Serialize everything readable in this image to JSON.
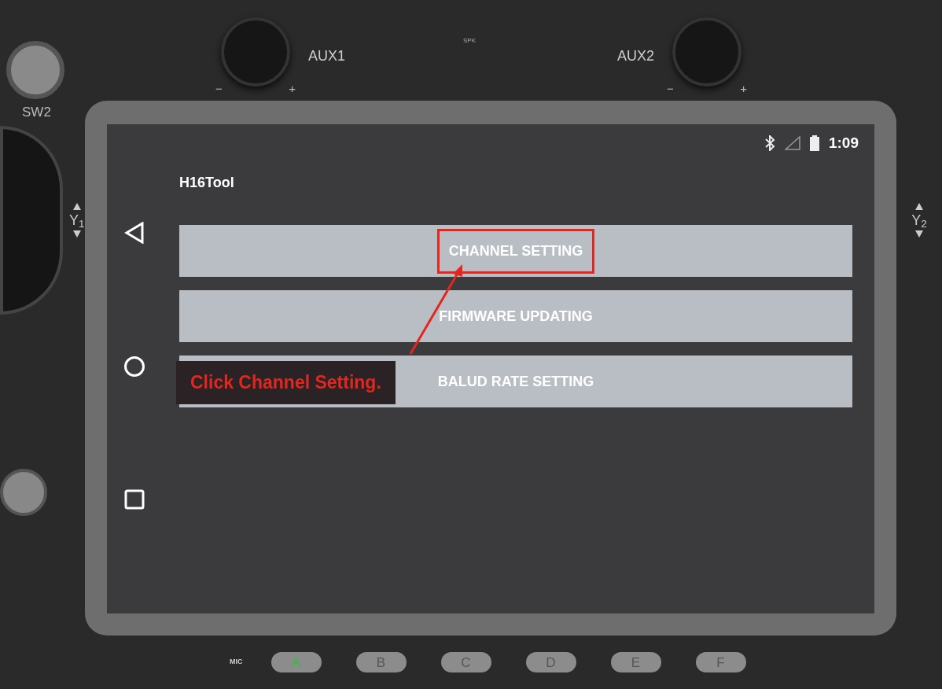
{
  "device": {
    "switch_label": "SW2",
    "knob_left": {
      "label": "AUX1",
      "minus": "−",
      "plus": "+"
    },
    "speaker_label": "SPK",
    "knob_right": {
      "label": "AUX2",
      "minus": "−",
      "plus": "+"
    },
    "stick_left_label": "Y$_{1}$",
    "stick_right_label": "Y$_{2}$",
    "mic_label": "MIC",
    "buttons": [
      {
        "label": "A",
        "lit": true
      },
      {
        "label": "B",
        "lit": false
      },
      {
        "label": "C",
        "lit": false
      },
      {
        "label": "D",
        "lit": false
      },
      {
        "label": "E",
        "lit": false
      },
      {
        "label": "F",
        "lit": false
      }
    ]
  },
  "screen": {
    "status_bar": {
      "time": "1:09"
    },
    "app_title": "H16Tool",
    "menu": [
      {
        "label": "CHANNEL SETTING",
        "highlighted": true
      },
      {
        "label": "FIRMWARE UPDATING",
        "highlighted": false
      },
      {
        "label": "BALUD RATE SETTING",
        "highlighted": false
      }
    ],
    "callout": {
      "text": "Click Channel Setting."
    }
  }
}
